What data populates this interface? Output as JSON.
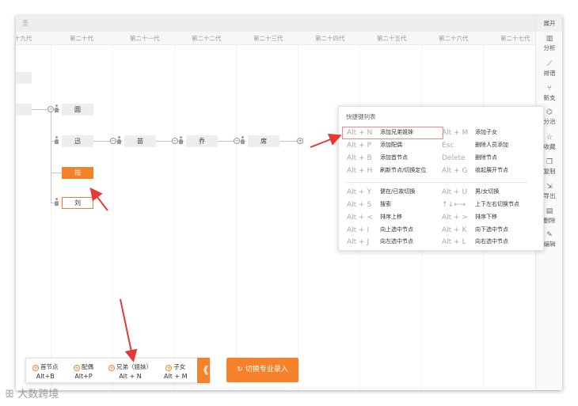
{
  "topbar": {
    "text": "圣"
  },
  "generations": [
    "十九代",
    "第二十代",
    "第二十一代",
    "第二十二代",
    "第二十三代",
    "第二十四代",
    "第二十五代",
    "第二十六代",
    "第二十七代"
  ],
  "tree": {
    "nodes": [
      {
        "label": ""
      },
      {
        "label": ""
      },
      {
        "label": "圆"
      },
      {
        "label": "迅"
      },
      {
        "label": "苗"
      },
      {
        "label": "乔"
      },
      {
        "label": "席"
      },
      {
        "label": "筠"
      },
      {
        "label": "刘"
      }
    ],
    "expand_symbol": "−",
    "add_symbol": "+"
  },
  "sidebar": {
    "expand_label": "展开",
    "items": [
      {
        "label": "分析",
        "icon": "bar-chart-icon",
        "glyph": "▥"
      },
      {
        "label": "排谱",
        "icon": "trend-icon",
        "glyph": "⟋"
      },
      {
        "label": "新支",
        "icon": "branch-icon",
        "glyph": "⑂"
      },
      {
        "label": "分治",
        "icon": "split-icon",
        "glyph": "⌬"
      },
      {
        "label": "收藏",
        "icon": "star-icon",
        "glyph": "☆"
      },
      {
        "label": "复制",
        "icon": "copy-icon",
        "glyph": "❐"
      },
      {
        "label": "导出",
        "icon": "export-icon",
        "glyph": "⇲"
      },
      {
        "label": "删除",
        "icon": "delete-icon",
        "glyph": "▤"
      },
      {
        "label": "编辑",
        "icon": "edit-icon",
        "glyph": "✎"
      }
    ]
  },
  "shortcuts": {
    "title": "快捷键列表",
    "items": [
      {
        "key": "Alt + N",
        "desc": "添加兄弟姐妹"
      },
      {
        "key": "Alt + M",
        "desc": "添加子女"
      },
      {
        "key": "Alt + P",
        "desc": "添加配偶"
      },
      {
        "key": "Esc",
        "desc": "删除人员添加"
      },
      {
        "key": "Alt + B",
        "desc": "添加首节点"
      },
      {
        "key": "Delete",
        "desc": "删除节点"
      },
      {
        "key": "Alt + H",
        "desc": "刷新节点/切换定位"
      },
      {
        "key": "Alt + G",
        "desc": "收起展开节点"
      },
      {
        "key": "Alt + Y",
        "desc": "健在/已故切换"
      },
      {
        "key": "Alt + U",
        "desc": "男/女切换"
      },
      {
        "key": "Alt + S",
        "desc": "搜索"
      },
      {
        "key": "↑↓←→",
        "desc": "上下左右切换节点"
      },
      {
        "key": "Alt + <",
        "desc": "排序上移"
      },
      {
        "key": "Alt + >",
        "desc": "排序下移"
      },
      {
        "key": "Alt + I",
        "desc": "向上选中节点"
      },
      {
        "key": "Alt + K",
        "desc": "向下选中节点"
      },
      {
        "key": "Alt + J",
        "desc": "向左选中节点"
      },
      {
        "key": "Alt + L",
        "desc": "向右选中节点"
      }
    ]
  },
  "bottom_toolbar": {
    "items": [
      {
        "label": "首节点",
        "key": "Alt+B"
      },
      {
        "label": "配偶",
        "key": "Alt+P"
      },
      {
        "label": "兄弟（姐妹）",
        "key": "Alt + N"
      },
      {
        "label": "子女",
        "key": "Alt + M"
      }
    ],
    "collapse_glyph": "《"
  },
  "switch_button": {
    "label": "切换专业录入",
    "glyph": "↻"
  },
  "watermark": "大数跨境",
  "colors": {
    "accent": "#f5822a",
    "annotation_arrow": "#e53935"
  }
}
